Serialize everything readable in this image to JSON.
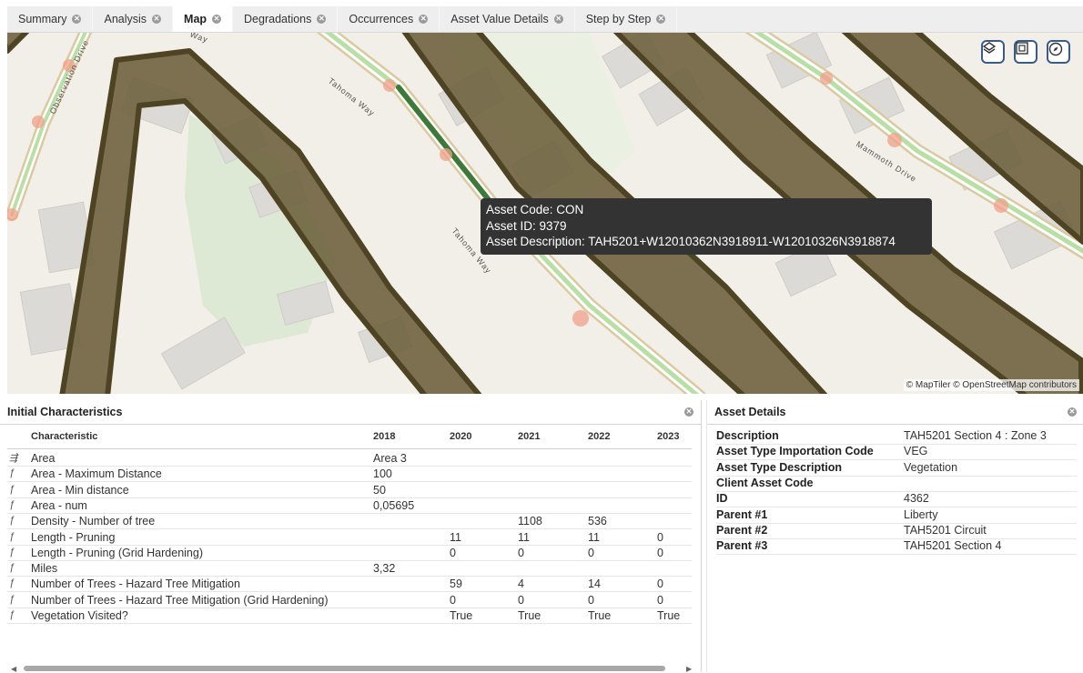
{
  "tabs": [
    {
      "label": "Summary"
    },
    {
      "label": "Analysis"
    },
    {
      "label": "Map"
    },
    {
      "label": "Degradations"
    },
    {
      "label": "Occurrences"
    },
    {
      "label": "Asset Value Details"
    },
    {
      "label": "Step by Step"
    }
  ],
  "map": {
    "street_labels": {
      "observation": "Observation Drive",
      "tahoma_1": "Tahoma Way",
      "tahoma_2": "Tahoma Way",
      "mammoth": "Mammoth Drive",
      "top": "Way"
    },
    "tooltip": {
      "line1": "Asset Code: CON",
      "line2": "Asset ID: 9379",
      "line3": "Asset Description: TAH5201+W12010362N3918911-W12010326N3918874"
    },
    "attribution": "© MapTiler © OpenStreetMap contributors",
    "controls": [
      "layers-icon",
      "fit-extent-icon",
      "compass-icon"
    ]
  },
  "initial": {
    "title": "Initial Characteristics",
    "columns": [
      "Characteristic",
      "2018",
      "2020",
      "2021",
      "2022",
      "2023"
    ],
    "rows": [
      {
        "icon": "list",
        "name": "Area",
        "c2018": "Area 3",
        "c2020": "",
        "c2021": "",
        "c2022": "",
        "c2023": ""
      },
      {
        "icon": "fx",
        "name": "Area - Maximum Distance",
        "c2018": "100",
        "c2020": "",
        "c2021": "",
        "c2022": "",
        "c2023": ""
      },
      {
        "icon": "fx",
        "name": "Area - Min distance",
        "c2018": "50",
        "c2020": "",
        "c2021": "",
        "c2022": "",
        "c2023": ""
      },
      {
        "icon": "fx",
        "name": "Area - num",
        "c2018": "0,05695",
        "c2020": "",
        "c2021": "",
        "c2022": "",
        "c2023": ""
      },
      {
        "icon": "fx",
        "name": "Density - Number of tree",
        "c2018": "",
        "c2020": "",
        "c2021": "1108",
        "c2022": "536",
        "c2023": ""
      },
      {
        "icon": "fx",
        "name": "Length - Pruning",
        "c2018": "",
        "c2020": "11",
        "c2021": "11",
        "c2022": "11",
        "c2023": "0"
      },
      {
        "icon": "fx",
        "name": "Length - Pruning (Grid Hardening)",
        "c2018": "",
        "c2020": "0",
        "c2021": "0",
        "c2022": "0",
        "c2023": "0"
      },
      {
        "icon": "fx",
        "name": "Miles",
        "c2018": "3,32",
        "c2020": "",
        "c2021": "",
        "c2022": "",
        "c2023": ""
      },
      {
        "icon": "fx",
        "name": "Number of Trees - Hazard Tree Mitigation",
        "c2018": "",
        "c2020": "59",
        "c2021": "4",
        "c2022": "14",
        "c2023": "0"
      },
      {
        "icon": "fx",
        "name": "Number of Trees - Hazard Tree Mitigation (Grid Hardening)",
        "c2018": "",
        "c2020": "0",
        "c2021": "0",
        "c2022": "0",
        "c2023": "0"
      },
      {
        "icon": "fx",
        "name": "Vegetation Visited?",
        "c2018": "",
        "c2020": "True",
        "c2021": "True",
        "c2022": "True",
        "c2023": "True"
      }
    ]
  },
  "asset": {
    "title": "Asset Details",
    "rows": [
      {
        "key": "Description",
        "value": "TAH5201 Section 4 : Zone 3"
      },
      {
        "key": "Asset Type Importation Code",
        "value": "VEG"
      },
      {
        "key": "Asset Type Description",
        "value": "Vegetation"
      },
      {
        "key": "Client Asset Code",
        "value": ""
      },
      {
        "key": "ID",
        "value": "4362"
      },
      {
        "key": "Parent #1",
        "value": "Liberty"
      },
      {
        "key": "Parent #2",
        "value": "TAH5201 Circuit"
      },
      {
        "key": "Parent #3",
        "value": "TAH5201 Section 4"
      }
    ]
  }
}
